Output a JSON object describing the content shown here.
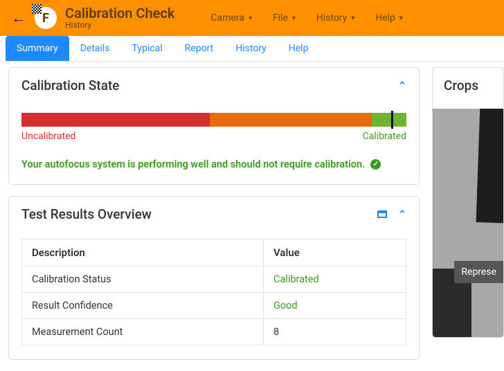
{
  "header": {
    "title": "Calibration Check",
    "subtitle": "History",
    "menus": [
      "Camera",
      "File",
      "History",
      "Help"
    ]
  },
  "subnav": {
    "items": [
      "Summary",
      "Details",
      "Typical",
      "Report",
      "History",
      "Help"
    ],
    "active": "Summary"
  },
  "calibration_state": {
    "panel_title": "Calibration State",
    "label_uncalibrated": "Uncalibrated",
    "label_calibrated": "Calibrated",
    "status_message": "Your autofocus system is performing well and should not require calibration."
  },
  "results": {
    "panel_title": "Test Results Overview",
    "columns": {
      "desc": "Description",
      "val": "Value"
    },
    "rows": [
      {
        "desc": "Calibration Status",
        "val": "Calibrated",
        "val_class": "good"
      },
      {
        "desc": "Result Confidence",
        "val": "Good",
        "val_class": "good"
      },
      {
        "desc": "Measurement Count",
        "val": "8",
        "val_class": ""
      }
    ]
  },
  "crops": {
    "panel_title": "Crops",
    "button_label": "Represe"
  }
}
